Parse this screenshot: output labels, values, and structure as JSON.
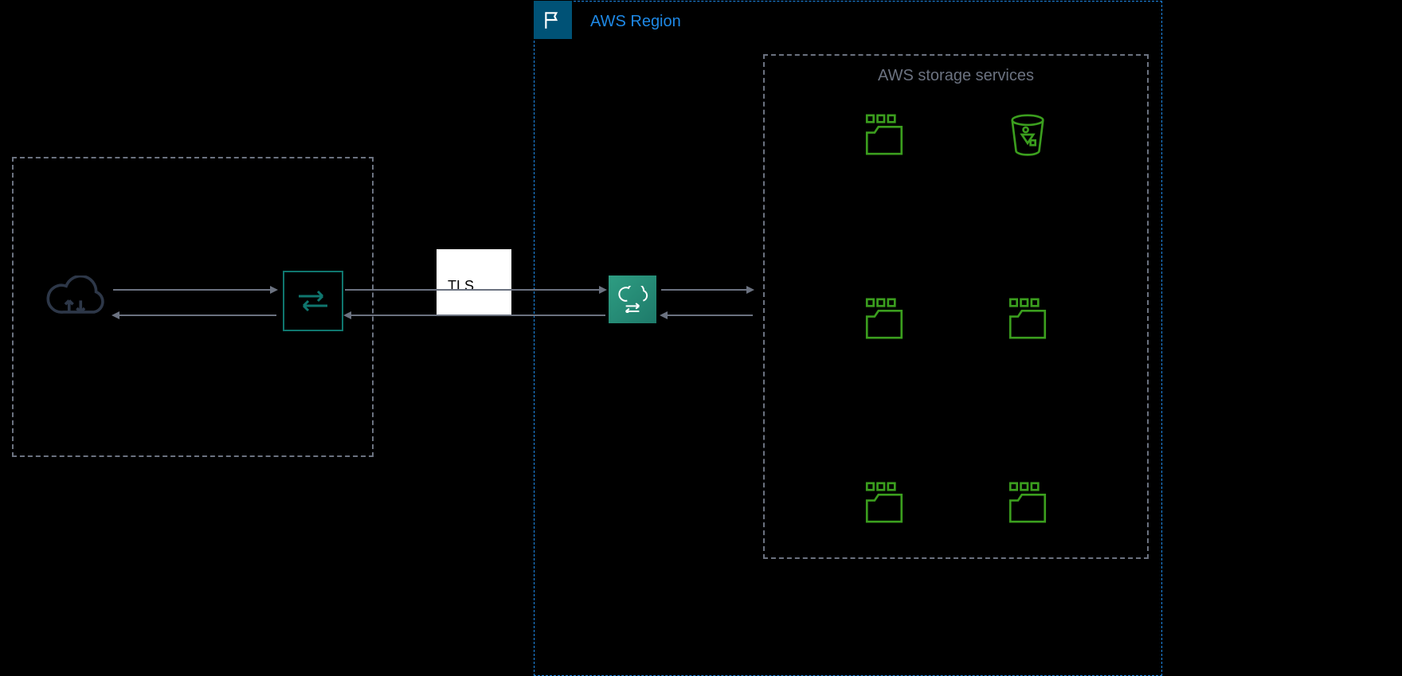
{
  "region": {
    "label": "AWS Region"
  },
  "storage": {
    "label": "AWS storage services"
  },
  "tls": {
    "label": "TLS"
  },
  "icons": {
    "cloud_sync": "cloud-sync-icon",
    "agent": "datasync-agent-icon",
    "service": "datasync-service-icon",
    "fsx": "fsx-icon",
    "s3": "s3-bucket-icon",
    "flag": "flag-icon"
  }
}
